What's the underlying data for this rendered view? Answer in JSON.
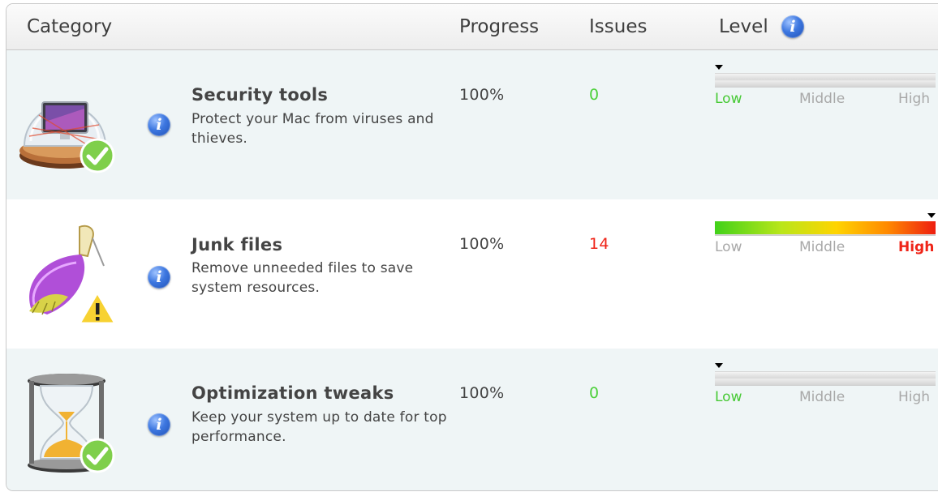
{
  "header": {
    "category": "Category",
    "progress": "Progress",
    "issues": "Issues",
    "level": "Level",
    "info_glyph": "i"
  },
  "colors": {
    "issues_ok": "#4cd03a",
    "issues_bad": "#ef2418",
    "row_alt_bg": "#eff5f6"
  },
  "rows": [
    {
      "icon": "security-monitor-globe-icon",
      "status_icon": "checkmark-icon",
      "title": "Security tools",
      "description": "Protect your Mac from viruses and thieves.",
      "progress": "100%",
      "issues": "0",
      "level": {
        "low": "Low",
        "middle": "Middle",
        "high": "High",
        "value_fraction": 0.0,
        "active": "Low"
      }
    },
    {
      "icon": "broom-icon",
      "status_icon": "warning-icon",
      "title": "Junk files",
      "description": "Remove unneeded files to save system resources.",
      "progress": "100%",
      "issues": "14",
      "level": {
        "low": "Low",
        "middle": "Middle",
        "high": "High",
        "value_fraction": 1.0,
        "active": "High"
      }
    },
    {
      "icon": "hourglass-icon",
      "status_icon": "checkmark-icon",
      "title": "Optimization tweaks",
      "description": "Keep your system up to date for top performance.",
      "progress": "100%",
      "issues": "0",
      "level": {
        "low": "Low",
        "middle": "Middle",
        "high": "High",
        "value_fraction": 0.0,
        "active": "Low"
      }
    }
  ]
}
